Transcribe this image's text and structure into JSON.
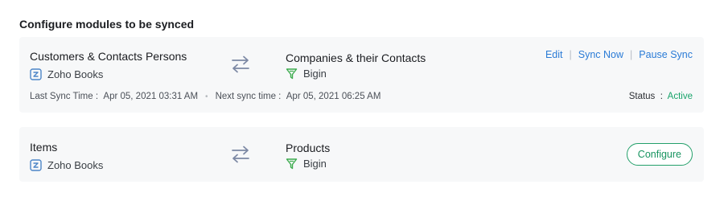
{
  "page": {
    "title": "Configure modules to be synced"
  },
  "modules": [
    {
      "source": {
        "name": "Customers & Contacts Persons",
        "app": "Zoho Books"
      },
      "target": {
        "name": "Companies & their Contacts",
        "app": "Bigin"
      },
      "actions": {
        "edit": "Edit",
        "sync_now": "Sync Now",
        "pause_sync": "Pause Sync"
      },
      "last_sync_label": "Last Sync Time",
      "last_sync_value": "Apr 05, 2021 03:31 AM",
      "next_sync_label": "Next sync time",
      "next_sync_value": "Apr 05, 2021 06:25 AM",
      "status_label": "Status",
      "status_value": "Active"
    },
    {
      "source": {
        "name": "Items",
        "app": "Zoho Books"
      },
      "target": {
        "name": "Products",
        "app": "Bigin"
      },
      "configure_label": "Configure"
    }
  ],
  "colors": {
    "link": "#2a7bd6",
    "active": "#18a36a",
    "card_bg": "#f7f8f9",
    "configure": "#23a06a"
  },
  "icons": {
    "source_app": "zoho-books-icon",
    "target_app": "bigin-icon",
    "sync": "sync-arrows-icon"
  }
}
